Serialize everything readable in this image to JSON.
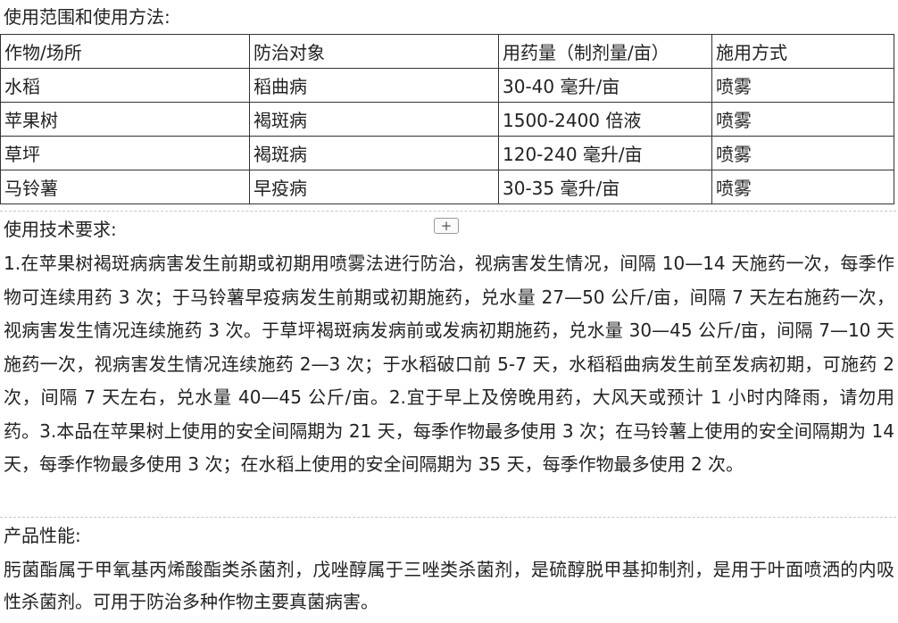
{
  "usage": {
    "title": "使用范围和使用方法:",
    "headers": [
      "作物/场所",
      "防治对象",
      "用药量（制剂量/亩）",
      "施用方式"
    ],
    "rows": [
      [
        "水稻",
        "稻曲病",
        "30-40 毫升/亩",
        "喷雾"
      ],
      [
        "苹果树",
        "褐斑病",
        "1500-2400 倍液",
        "喷雾"
      ],
      [
        "草坪",
        "褐斑病",
        "120-240 毫升/亩",
        "喷雾"
      ],
      [
        "马铃薯",
        "早疫病",
        "30-35 毫升/亩",
        "喷雾"
      ]
    ]
  },
  "tech": {
    "title": "使用技术要求:",
    "expand_label": "+",
    "text": "1.在苹果树褐斑病病害发生前期或初期用喷雾法进行防治，视病害发生情况，间隔 10—14 天施药一次，每季作物可连续用药 3 次；于马铃薯早疫病发生前期或初期施药，兑水量 27—50 公斤/亩，间隔 7 天左右施药一次，视病害发生情况连续施药 3 次。于草坪褐斑病发病前或发病初期施药，兑水量 30—45 公斤/亩，间隔 7—10 天施药一次，视病害发生情况连续施药 2—3 次；于水稻破口前 5-7 天，水稻稻曲病发生前至发病初期，可施药 2 次，间隔 7 天左右，兑水量 40—45 公斤/亩。2.宜于早上及傍晚用药，大风天或预计 1 小时内降雨，请勿用药。3.本品在苹果树上使用的安全间隔期为 21 天，每季作物最多使用 3 次；在马铃薯上使用的安全间隔期为 14 天，每季作物最多使用 3 次；在水稻上使用的安全间隔期为 35 天，每季作物最多使用 2 次。"
  },
  "performance": {
    "title": "产品性能:",
    "text": "肟菌酯属于甲氧基丙烯酸酯类杀菌剂，戊唑醇属于三唑类杀菌剂，是硫醇脱甲基抑制剂，是用于叶面喷洒的内吸性杀菌剂。可用于防治多种作物主要真菌病害。"
  }
}
